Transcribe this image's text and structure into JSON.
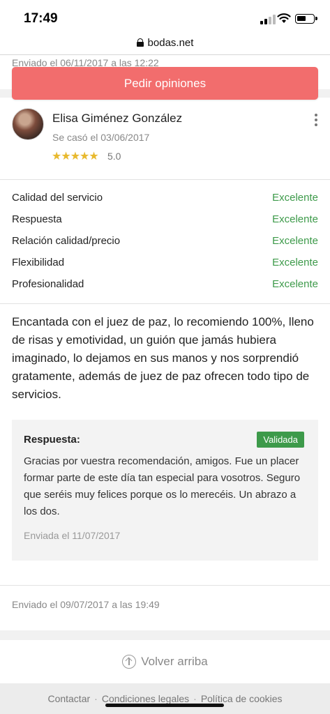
{
  "status_bar": {
    "time": "17:49"
  },
  "browser": {
    "url": "bodas.net"
  },
  "previous_review": {
    "sent": "Enviado el 06/11/2017 a las 12:22"
  },
  "cta": {
    "label": "Pedir opiniones",
    "color": "#f26d6d"
  },
  "review": {
    "reviewer_name": "Elisa Giménez González",
    "married": "Se casó el 03/06/2017",
    "stars": "★★★★★",
    "rating": "5.0",
    "ratings": [
      {
        "label": "Calidad del servicio",
        "value": "Excelente"
      },
      {
        "label": "Respuesta",
        "value": "Excelente"
      },
      {
        "label": "Relación calidad/precio",
        "value": "Excelente"
      },
      {
        "label": "Flexibilidad",
        "value": "Excelente"
      },
      {
        "label": "Profesionalidad",
        "value": "Excelente"
      }
    ],
    "text": "Encantada con el juez de paz, lo recomiendo 100%, lleno de risas y emotividad, un guión que jamás hubiera imaginado, lo dejamos en sus manos y nos sorprendió gratamente, además de juez de paz ofrecen todo tipo de servicios.",
    "response": {
      "title": "Respuesta:",
      "badge": "Validada",
      "text": "Gracias por vuestra recomendación, amigos. Fue un placer formar parte de este día tan especial para vosotros. Seguro que seréis muy felices porque os lo merecéis. Un abrazo a los dos.",
      "date": "Enviada el 11/07/2017"
    },
    "sent": "Enviado el 09/07/2017 a las 19:49"
  },
  "back_to_top": {
    "label": "Volver arriba"
  },
  "footer": {
    "links": [
      "Contactar",
      "Condiciones legales",
      "Política de cookies"
    ],
    "separator": "·"
  },
  "colors": {
    "accent": "#f26d6d",
    "success": "#3d9a4a",
    "star": "#e8b92e"
  }
}
